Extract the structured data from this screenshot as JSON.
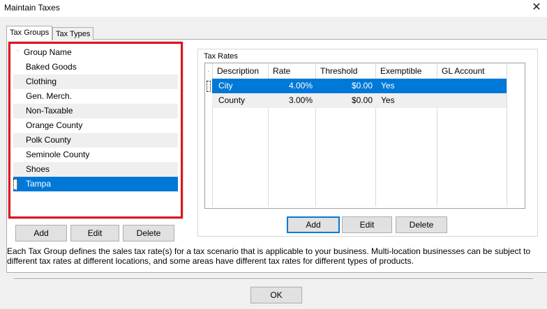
{
  "window": {
    "title": "Maintain Taxes",
    "close_glyph": "✕"
  },
  "tabs": [
    {
      "label": "Tax Groups",
      "active": true
    },
    {
      "label": "Tax Types",
      "active": false
    }
  ],
  "groups": {
    "header": "Group Name",
    "items": [
      "Baked Goods",
      "Clothing",
      "Gen. Merch.",
      "Non-Taxable",
      "Orange County",
      "Polk County",
      "Seminole County",
      "Shoes",
      "Tampa"
    ],
    "selected": "Tampa",
    "buttons": {
      "add": "Add",
      "edit": "Edit",
      "delete": "Delete"
    }
  },
  "tax_rates": {
    "legend": "Tax Rates",
    "columns": [
      "Description",
      "Rate",
      "Threshold",
      "Exemptible",
      "GL Account"
    ],
    "rows": [
      {
        "description": "City",
        "rate": "4.00%",
        "threshold": "$0.00",
        "exemptible": "Yes",
        "gl_account": ""
      },
      {
        "description": "County",
        "rate": "3.00%",
        "threshold": "$0.00",
        "exemptible": "Yes",
        "gl_account": ""
      }
    ],
    "buttons": {
      "add": "Add",
      "edit": "Edit",
      "delete": "Delete"
    }
  },
  "description": "Each Tax Group defines the sales tax rate(s) for a tax scenario that is applicable to your business. Multi-location businesses can be subject to different tax rates at different locations, and some areas have different tax rates for different types of products.",
  "footer": {
    "ok": "OK"
  },
  "colors": {
    "selection": "#0078d7",
    "highlight_frame": "#e0141e",
    "stripe": "#efefef"
  }
}
